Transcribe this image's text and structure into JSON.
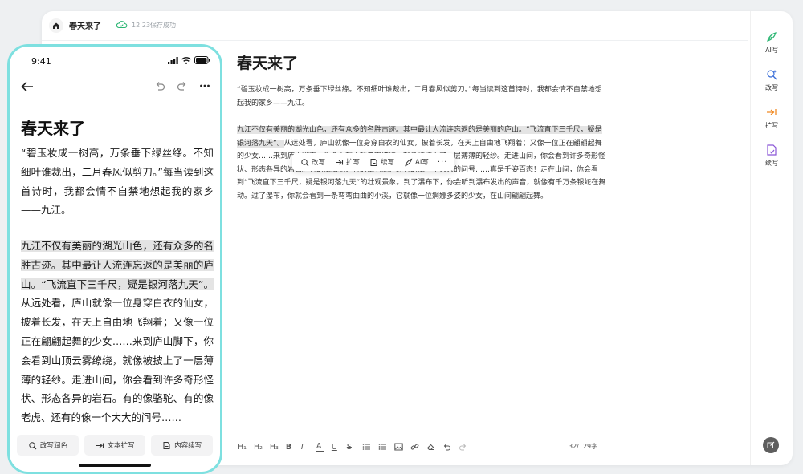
{
  "app": {
    "doc_tab_title": "春天来了",
    "save_status": "12:23保存成功"
  },
  "document": {
    "title": "春天来了",
    "para1": "“碧玉妆成一树高，万条垂下绿丝绦。不知细叶谁裁出，二月春风似剪刀。”每当读到这首诗时，我都会情不自禁地想起我的家乡——九江。",
    "para2_highlight": "九江不仅有美丽的湖光山色，还有众多的名胜古迹。其中最让人流连忘返的是美丽的庐山。“飞流直下三千尺，疑是银河落九天”。",
    "para2_rest": "从远处看，庐山就像一位身穿白衣的仙女，披着长发，在天上自由地飞翔着；又像一位正在翩翩起舞的少女……来到庐山脚下，你会看到山顶云雾缭绕，就像被披上了一层薄薄的轻纱。走进山间，你会看到许多奇形怪状、形态各异的岩石。有的像骆驼、有的像老虎、还有的像一个大大的问号……真是千姿百态！走在山间，你会看到“飞流直下三千尺，疑是银河落九天”的壮观景象。到了瀑布下，你会听到瀑布发出的声音，就像有千万条银蛇在舞动。过了瀑布，你就会看到一条弯弯曲曲的小溪，它就像一位婀娜多姿的少女，在山间翩翩起舞。"
  },
  "float_toolbar": {
    "rewrite": "改写",
    "expand": "扩写",
    "continue": "续写",
    "ai_write": "AI写",
    "more": "···"
  },
  "format_bar": {
    "h1": "H₁",
    "h2": "H₂",
    "h3": "H₃",
    "bold": "B",
    "italic": "I",
    "color": "A",
    "underline": "U",
    "strike": "S"
  },
  "word_count": "32/129字",
  "side_panel": {
    "ai_write": "AI写",
    "rewrite": "改写",
    "expand": "扩写",
    "continue": "续写"
  },
  "phone": {
    "time": "9:41",
    "title": "春天来了",
    "para1": "“碧玉妆成一树高，万条垂下绿丝绦。不知细叶谁裁出，二月春风似剪刀。”每当读到这首诗时，我都会情不自禁地想起我的家乡——九江。",
    "para2_highlight": "九江不仅有美丽的湖光山色，还有众多的名胜古迹。其中最让人流连忘返的是美丽的庐山。“飞流直下三千尺，疑是银河落九天”。",
    "para2_rest": "从远处看，庐山就像一位身穿白衣的仙女，披着长发，在天上自由地飞翔着；又像一位正在翩翩起舞的少女……来到庐山脚下，你会看到山顶云雾缭绕，就像被披上了一层薄薄的轻纱。走进山间，你会看到许多奇形怪状、形态各异的岩石。有的像骆驼、有的像老虎、还有的像一个大大的问号……",
    "btn_polish": "改写润色",
    "btn_expand": "文本扩写",
    "btn_continue": "内容续写"
  },
  "colors": {
    "accent_green": "#2bb673",
    "rewrite_blue": "#3b6fd8",
    "expand_orange": "#f08a24",
    "continue_purple": "#8a56d6",
    "phone_border": "#7ee0e0",
    "highlight": "#e4e4e4"
  }
}
